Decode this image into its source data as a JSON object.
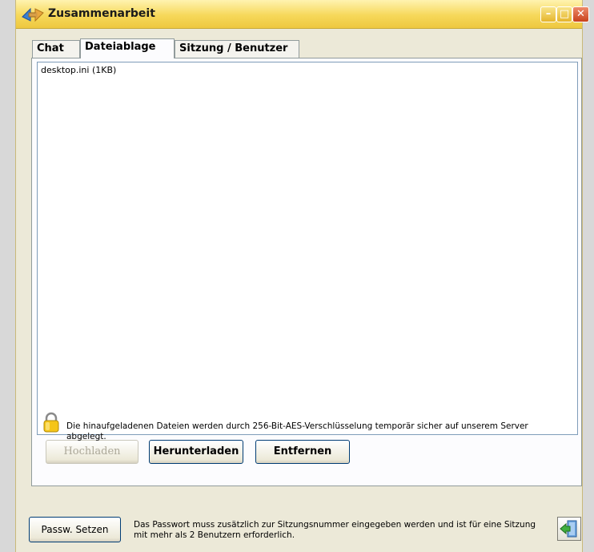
{
  "window": {
    "title": "Zusammenarbeit"
  },
  "tabs": [
    {
      "label": "Chat"
    },
    {
      "label": "Dateiablage"
    },
    {
      "label": "Sitzung / Benutzer"
    }
  ],
  "files": [
    "desktop.ini (1KB)"
  ],
  "buttons": {
    "upload": "Hochladen",
    "download": "Herunterladen",
    "remove": "Entfernen",
    "set_password": "Passw. Setzen"
  },
  "info": {
    "encryption": "Die hinaufgeladenen Dateien werden durch 256-Bit-AES-Verschlüsselung temporär sicher auf unserem Server abgelegt.",
    "password": "Das Passwort muss zusätzlich zur Sitzungsnummer eingegeben werden und ist für eine Sitzung mit mehr als 2 Benutzern erforderlich."
  },
  "icons": {
    "app": "collaboration-arrows-icon",
    "lock": "padlock-icon",
    "exit": "exit-door-icon"
  }
}
